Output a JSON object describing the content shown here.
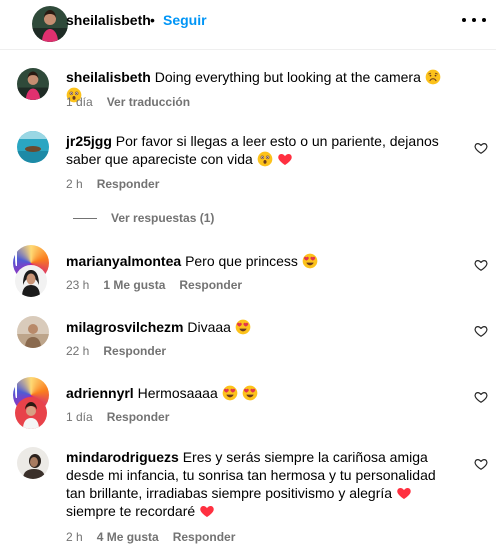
{
  "post_header": {
    "username": "sheilalisbeth",
    "separator": "•",
    "follow_label": "Seguir"
  },
  "caption": {
    "username": "sheilalisbeth",
    "text": "Doing everything but looking at the camera",
    "time": "1 día",
    "translate_label": "Ver traducción"
  },
  "comments": [
    {
      "username": "jr25jgg",
      "text": "Por favor si llegas a leer esto o un pariente, dejanos saber que apareciste con vida",
      "time": "2 h",
      "likes": "",
      "reply_label": "Responder",
      "view_replies": "Ver respuestas (1)"
    },
    {
      "username": "marianyalmontea",
      "text": "Pero que princess",
      "time": "23 h",
      "likes": "1 Me gusta",
      "reply_label": "Responder"
    },
    {
      "username": "milagrosvilchezm",
      "text": "Divaaa",
      "time": "22 h",
      "likes": "",
      "reply_label": "Responder"
    },
    {
      "username": "adriennyrl",
      "text": "Hermosaaaa",
      "time": "1 día",
      "likes": "",
      "reply_label": "Responder"
    },
    {
      "username": "mindarodriguezs",
      "text_part1": "Eres y serás siempre la cariñosa amiga desde mi infancia, tu sonrisa tan hermosa y tu personalidad tan brillante, irradiabas siempre positivismo y alegría",
      "text_part2": "siempre te recordaré",
      "time": "2 h",
      "likes": "4 Me gusta",
      "reply_label": "Responder"
    }
  ],
  "icons": {
    "more": "more-options-icon",
    "like": "heart-outline-icon",
    "emoji_sad": "sad-face-emoji",
    "emoji_shock": "astonished-face-emoji",
    "emoji_love": "heart-eyes-emoji",
    "emoji_heart": "red-heart-emoji"
  },
  "colors": {
    "link": "#0095f6",
    "muted": "#737373",
    "heart": "#ff3040",
    "emoji_yellow": "#fcc21b"
  }
}
